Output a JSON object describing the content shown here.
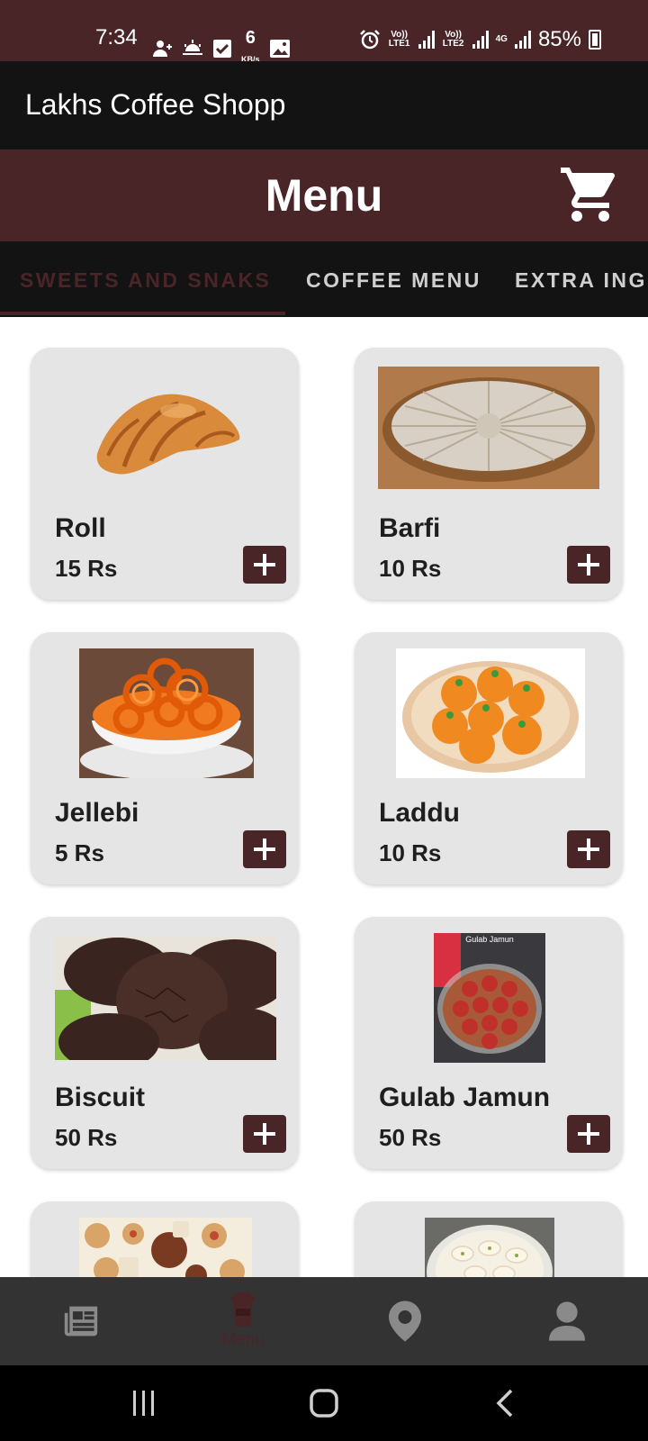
{
  "status": {
    "time": "7:34",
    "speed_value": "6",
    "speed_unit": "KB/s",
    "net1": "Vo)) LTE1",
    "net2": "Vo)) LTE2",
    "net3": "4G",
    "battery": "85%"
  },
  "app": {
    "title": "Lakhs Coffee Shopp"
  },
  "header": {
    "title": "Menu",
    "cart_icon": "shopping-cart-icon"
  },
  "tabs": [
    {
      "label": "SWEETS AND SNAKS",
      "active": true
    },
    {
      "label": "COFFEE MENU",
      "active": false
    },
    {
      "label": "EXTRA ING",
      "active": false
    }
  ],
  "items": [
    {
      "name": "Roll",
      "price": "15 Rs",
      "image": "croissant"
    },
    {
      "name": "Barfi",
      "price": "10 Rs",
      "image": "kaju-barfi"
    },
    {
      "name": "Jellebi",
      "price": "5 Rs",
      "image": "jalebi"
    },
    {
      "name": "Laddu",
      "price": "10 Rs",
      "image": "laddu"
    },
    {
      "name": "Biscuit",
      "price": "50 Rs",
      "image": "chocolate-cookies"
    },
    {
      "name": "Gulab Jamun",
      "price": "50 Rs",
      "image": "gulab-jamun",
      "image_caption": "Gulab Jamun"
    },
    {
      "image": "assorted-cookies"
    },
    {
      "image": "rasmalai"
    }
  ],
  "bottom_nav": [
    {
      "icon": "news-icon",
      "label": ""
    },
    {
      "icon": "coffee-cup-icon",
      "label": "Menu",
      "active": true
    },
    {
      "icon": "location-pin-icon",
      "label": ""
    },
    {
      "icon": "person-icon",
      "label": ""
    }
  ],
  "colors": {
    "primary": "#4a2528",
    "dark": "#141313",
    "card": "#e6e5e5",
    "nav": "#333333"
  }
}
